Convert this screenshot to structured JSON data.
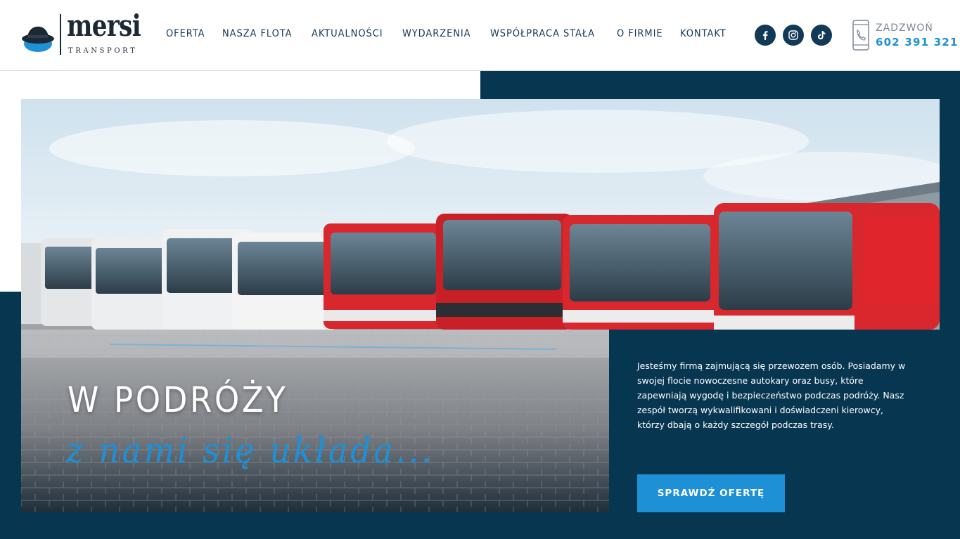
{
  "brand": {
    "name": "mersi",
    "tagline": "TRANSPORT",
    "colors": {
      "navy": "#123a57",
      "hero_bg": "#073651",
      "accent": "#1e90d6",
      "bus_red": "#d8282e"
    }
  },
  "nav": {
    "items": [
      {
        "label": "OFERTA"
      },
      {
        "label": "NASZA FLOTA"
      },
      {
        "label": "AKTUALNOŚCI"
      },
      {
        "label": "WYDARZENIA"
      },
      {
        "label": "WSPÓŁPRACA STAŁA"
      },
      {
        "label": "O FIRMIE"
      },
      {
        "label": "KONTAKT"
      }
    ]
  },
  "social": [
    {
      "icon": "facebook-icon"
    },
    {
      "icon": "instagram-icon"
    },
    {
      "icon": "tiktok-icon"
    }
  ],
  "contact": {
    "icon": "phone-icon",
    "label": "ZADZWOŃ",
    "number": "602 391 321"
  },
  "hero": {
    "title": "W PODRÓŻY",
    "subtitle": "z nami się układa...",
    "description": "Jesteśmy firmą zajmującą się przewozem osób. Posiadamy w swojej flocie nowoczesne autokary oraz busy, które zapewniają wygodę i bezpieczeństwo podczas podróży. Nasz zespół tworzą wykwalifikowani i doświadczeni kierowcy, którzy dbają o każdy szczegół podczas trasy.",
    "cta_label": "SPRAWDŹ OFERTĘ"
  }
}
